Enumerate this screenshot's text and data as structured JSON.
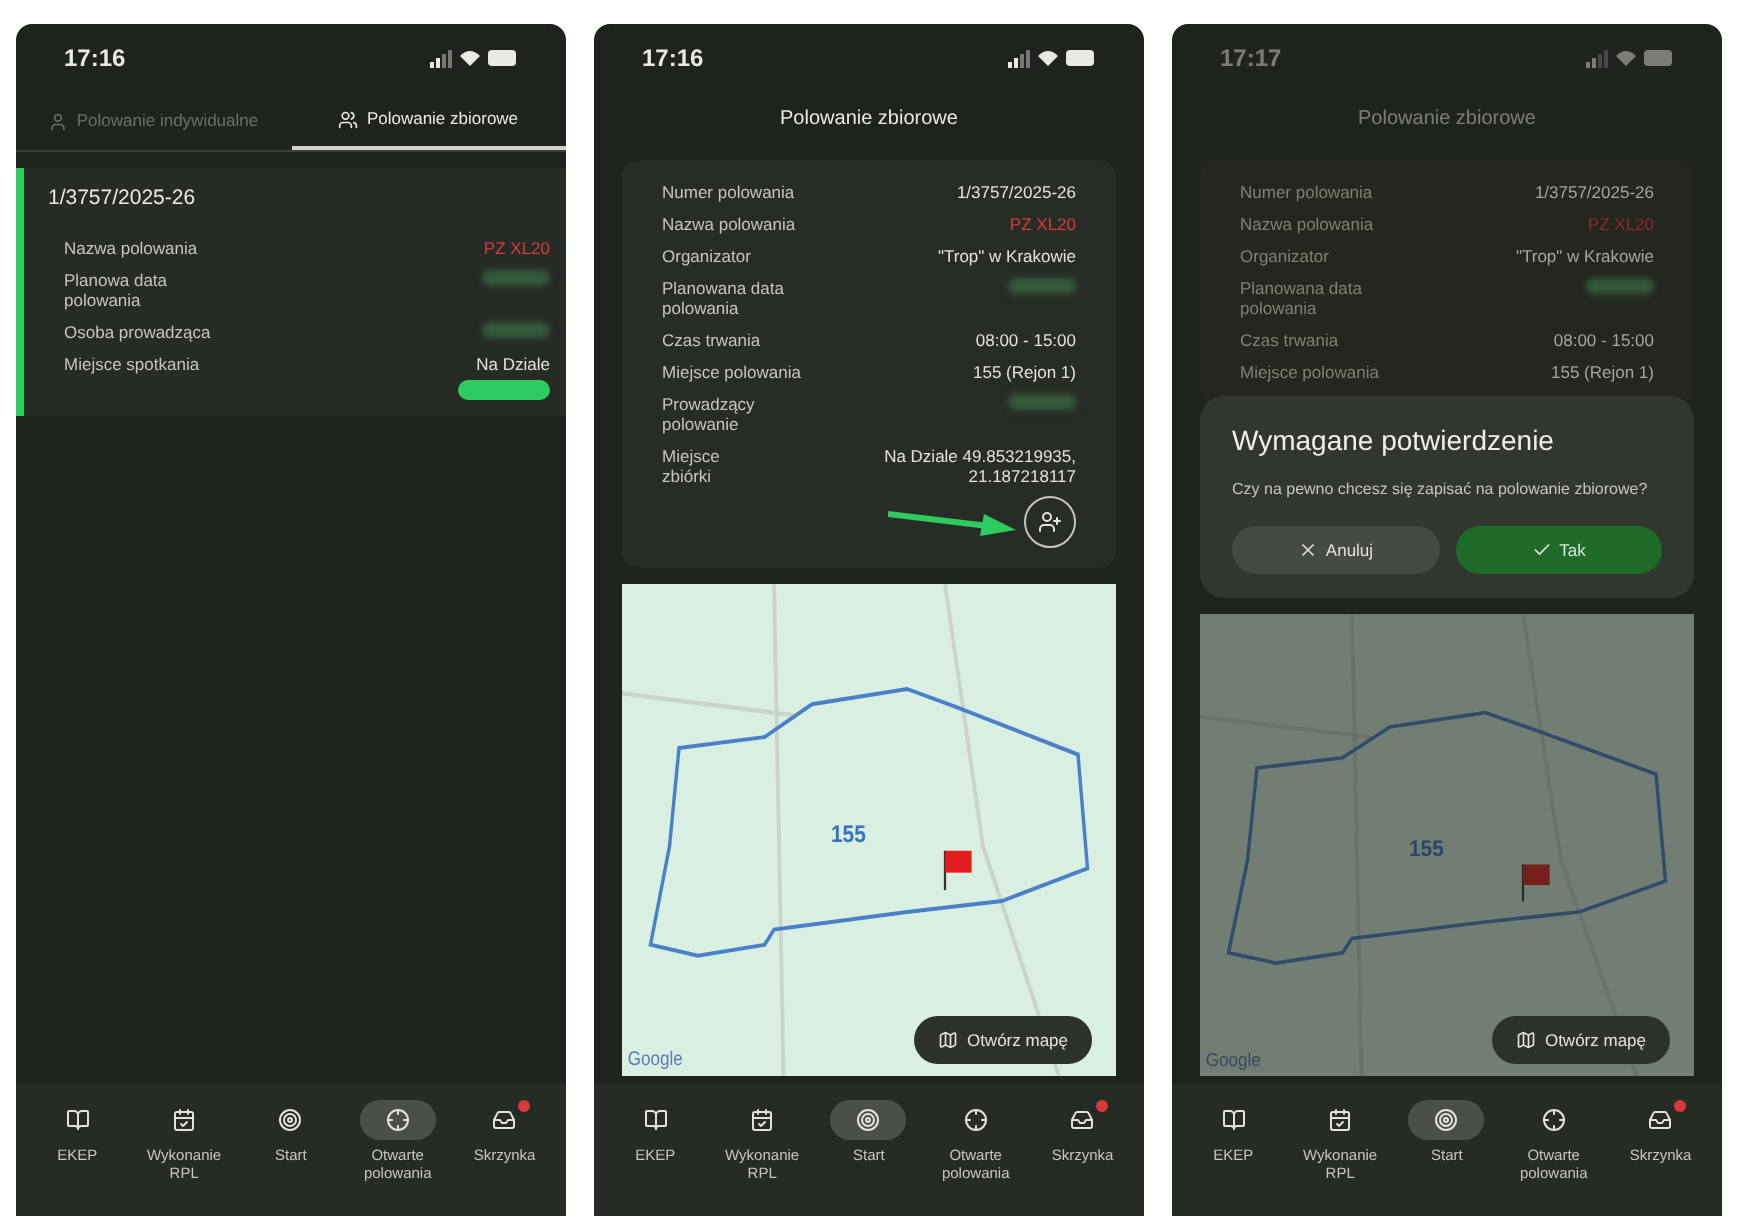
{
  "screens": [
    {
      "kind": "list",
      "status_bar": {
        "time": "17:16"
      },
      "tabs": [
        {
          "label": "Polowanie indywidualne",
          "selected": false
        },
        {
          "label": "Polowanie zbiorowe",
          "selected": true
        }
      ],
      "card": {
        "number": "1/3757/2025-26",
        "rows": [
          {
            "label": "Nazwa polowania",
            "value": "PZ XL20",
            "color": "#d8393a"
          },
          {
            "label": "Planowa data polowania",
            "redacted": true
          },
          {
            "label": "Osoba prowadząca",
            "redacted": true
          },
          {
            "label": "Miejsce spotkania",
            "value": "Na Dziale"
          }
        ],
        "status_pill": true
      },
      "nav": [
        {
          "label": "EKEP",
          "selected": false
        },
        {
          "label": "Wykonanie RPL",
          "selected": false
        },
        {
          "label": "Start",
          "selected": false
        },
        {
          "label": "Otwarte polowania",
          "selected": true
        },
        {
          "label": "Skrzynka",
          "selected": false,
          "badge": true
        }
      ]
    },
    {
      "kind": "detail",
      "status_bar": {
        "time": "17:16"
      },
      "header": "Polowanie zbiorowe",
      "rows": [
        {
          "label": "Numer polowania",
          "value": "1/3757/2025-26"
        },
        {
          "label": "Nazwa polowania",
          "value": "PZ XL20",
          "color": "#d8393a"
        },
        {
          "label": "Organizator",
          "value": "\"Trop\" w Krakowie"
        },
        {
          "label": "Planowana data polowania",
          "redacted": true
        },
        {
          "label": "Czas trwania",
          "value": "08:00 - 15:00"
        },
        {
          "label": "Miejsce polowania",
          "value": "155 (Rejon 1)"
        },
        {
          "label": "Prowadzący polowanie",
          "redacted": true
        },
        {
          "label": "Miejsce zbiórki",
          "value": "Na Dziale 49.853219935, 21.187218117"
        }
      ],
      "join_button": true,
      "annotation_arrow": true,
      "map": {
        "region": "155",
        "attribution": "Google",
        "open_button": "Otwórz mapę"
      },
      "nav": [
        {
          "label": "EKEP",
          "selected": false
        },
        {
          "label": "Wykonanie RPL",
          "selected": false
        },
        {
          "label": "Start",
          "selected": true
        },
        {
          "label": "Otwarte polowania",
          "selected": false
        },
        {
          "label": "Skrzynka",
          "selected": false,
          "badge": true
        }
      ]
    },
    {
      "kind": "detail",
      "status_bar": {
        "time": "17:17"
      },
      "header": "Polowanie zbiorowe",
      "rows": [
        {
          "label": "Numer polowania",
          "value": "1/3757/2025-26"
        },
        {
          "label": "Nazwa polowania",
          "value": "PZ XL20",
          "color": "#8e2a2b"
        },
        {
          "label": "Organizator",
          "value": "\"Trop\" w Krakowie"
        },
        {
          "label": "Planowana data polowania",
          "redacted": true
        },
        {
          "label": "Czas trwania",
          "value": "08:00 - 15:00"
        },
        {
          "label": "Miejsce polowania",
          "value": "155 (Rejon 1)"
        }
      ],
      "dialog": {
        "title": "Wymagane potwierdzenie",
        "message": "Czy na pewno chcesz się zapisać na polowanie zbiorowe?",
        "buttons": [
          {
            "label": "Anuluj",
            "kind": "cancel"
          },
          {
            "label": "Tak",
            "kind": "confirm"
          }
        ]
      },
      "map": {
        "region": "155",
        "attribution": "Google",
        "open_button": "Otwórz mapę"
      },
      "nav": [
        {
          "label": "EKEP",
          "selected": false
        },
        {
          "label": "Wykonanie RPL",
          "selected": false
        },
        {
          "label": "Start",
          "selected": true
        },
        {
          "label": "Otwarte polowania",
          "selected": false
        },
        {
          "label": "Skrzynka",
          "selected": false,
          "badge": true
        }
      ]
    }
  ]
}
